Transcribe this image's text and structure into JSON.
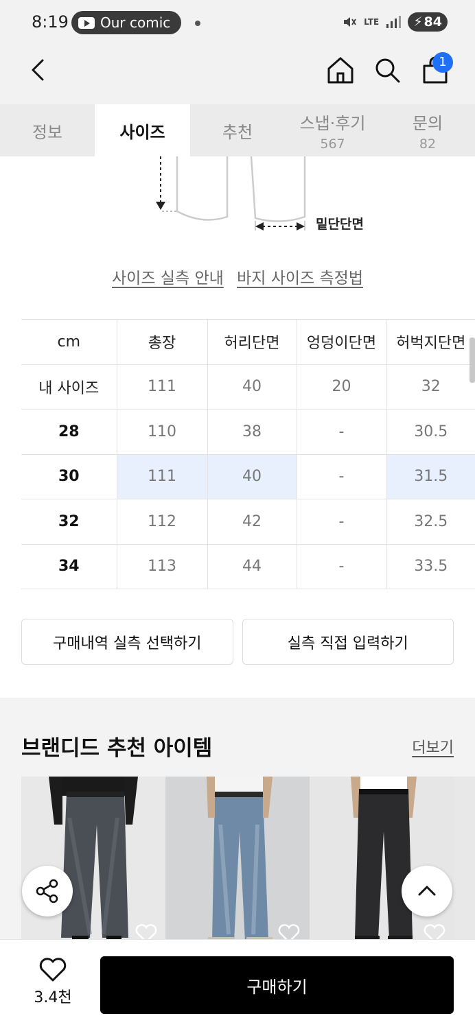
{
  "status_bar": {
    "time": "8:19",
    "notification_pill": "Our comic",
    "network": "LTE",
    "battery": "84"
  },
  "header": {
    "cart_count": "1"
  },
  "tabs": [
    {
      "label": "정보",
      "count": ""
    },
    {
      "label": "사이즈",
      "count": ""
    },
    {
      "label": "추천",
      "count": ""
    },
    {
      "label": "스냅·후기",
      "count": "567"
    },
    {
      "label": "문의",
      "count": "82"
    }
  ],
  "diagram": {
    "hem_label": "밑단단면"
  },
  "links": {
    "size_guide": "사이즈 실측 안내",
    "pants_measure": "바지 사이즈 측정법"
  },
  "size_table": {
    "headers": [
      "cm",
      "총장",
      "허리단면",
      "엉덩이단면",
      "허벅지단면"
    ],
    "rows": [
      [
        "내 사이즈",
        "111",
        "40",
        "20",
        "32"
      ],
      [
        "28",
        "110",
        "38",
        "-",
        "30.5"
      ],
      [
        "30",
        "111",
        "40",
        "-",
        "31.5"
      ],
      [
        "32",
        "112",
        "42",
        "-",
        "32.5"
      ],
      [
        "34",
        "113",
        "44",
        "-",
        "33.5"
      ]
    ]
  },
  "buttons": {
    "purchase_history": "구매내역 실측 선택하기",
    "manual_input": "실측 직접 입력하기"
  },
  "recommend": {
    "title": "브랜디드 추천 아이템",
    "more": "더보기"
  },
  "bottom": {
    "like_count": "3.4천",
    "buy": "구매하기"
  },
  "colors": {
    "accent_badge": "#1f6ff7",
    "highlight_cell": "#e8effd",
    "buy_button": "#000000"
  }
}
